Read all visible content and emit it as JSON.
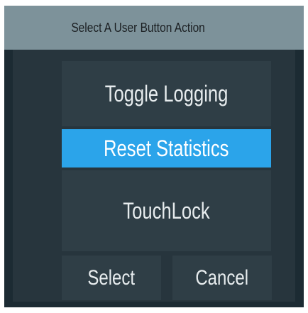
{
  "dialog": {
    "title": "Select A User Button Action",
    "actions": [
      {
        "label": "Toggle Logging",
        "selected": false
      },
      {
        "label": "Reset Statistics",
        "selected": true
      },
      {
        "label": "TouchLock",
        "selected": false
      }
    ],
    "footer": {
      "select_label": "Select",
      "cancel_label": "Cancel"
    }
  },
  "colors": {
    "title_bar": "#7d929a",
    "dialog_background": "#1c2b33",
    "button_background": "#2f3e46",
    "selected_highlight": "#2ba4ea",
    "button_text": "#e7ecee"
  }
}
